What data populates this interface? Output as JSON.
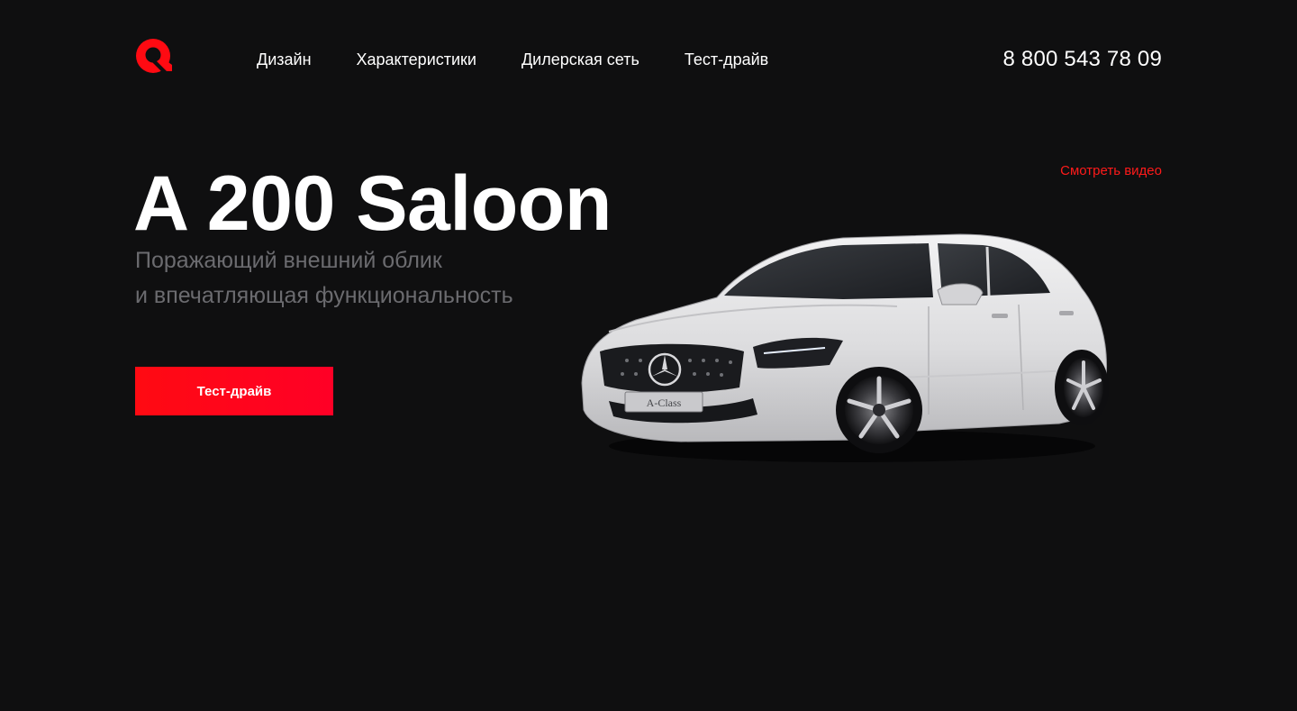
{
  "header": {
    "logo_icon": "brand-logo-icon",
    "nav": [
      {
        "label": "Дизайн"
      },
      {
        "label": "Характеристики"
      },
      {
        "label": "Дилерская сеть"
      },
      {
        "label": "Тест-драйв"
      }
    ],
    "phone": "8 800 543 78 09"
  },
  "hero": {
    "title": "A 200 Saloon",
    "subtitle_line1": "Поражающий внешний облик",
    "subtitle_line2": "и впечатляющая функциональность",
    "video_link": "Смотреть видео",
    "cta_label": "Тест-драйв",
    "car_badge": "A-Class",
    "car_image": "white-hatchback-car-image"
  },
  "colors": {
    "background": "#0f0f10",
    "accent": "#ff0a12",
    "subtitle": "#6b6b6f",
    "text": "#ffffff"
  }
}
